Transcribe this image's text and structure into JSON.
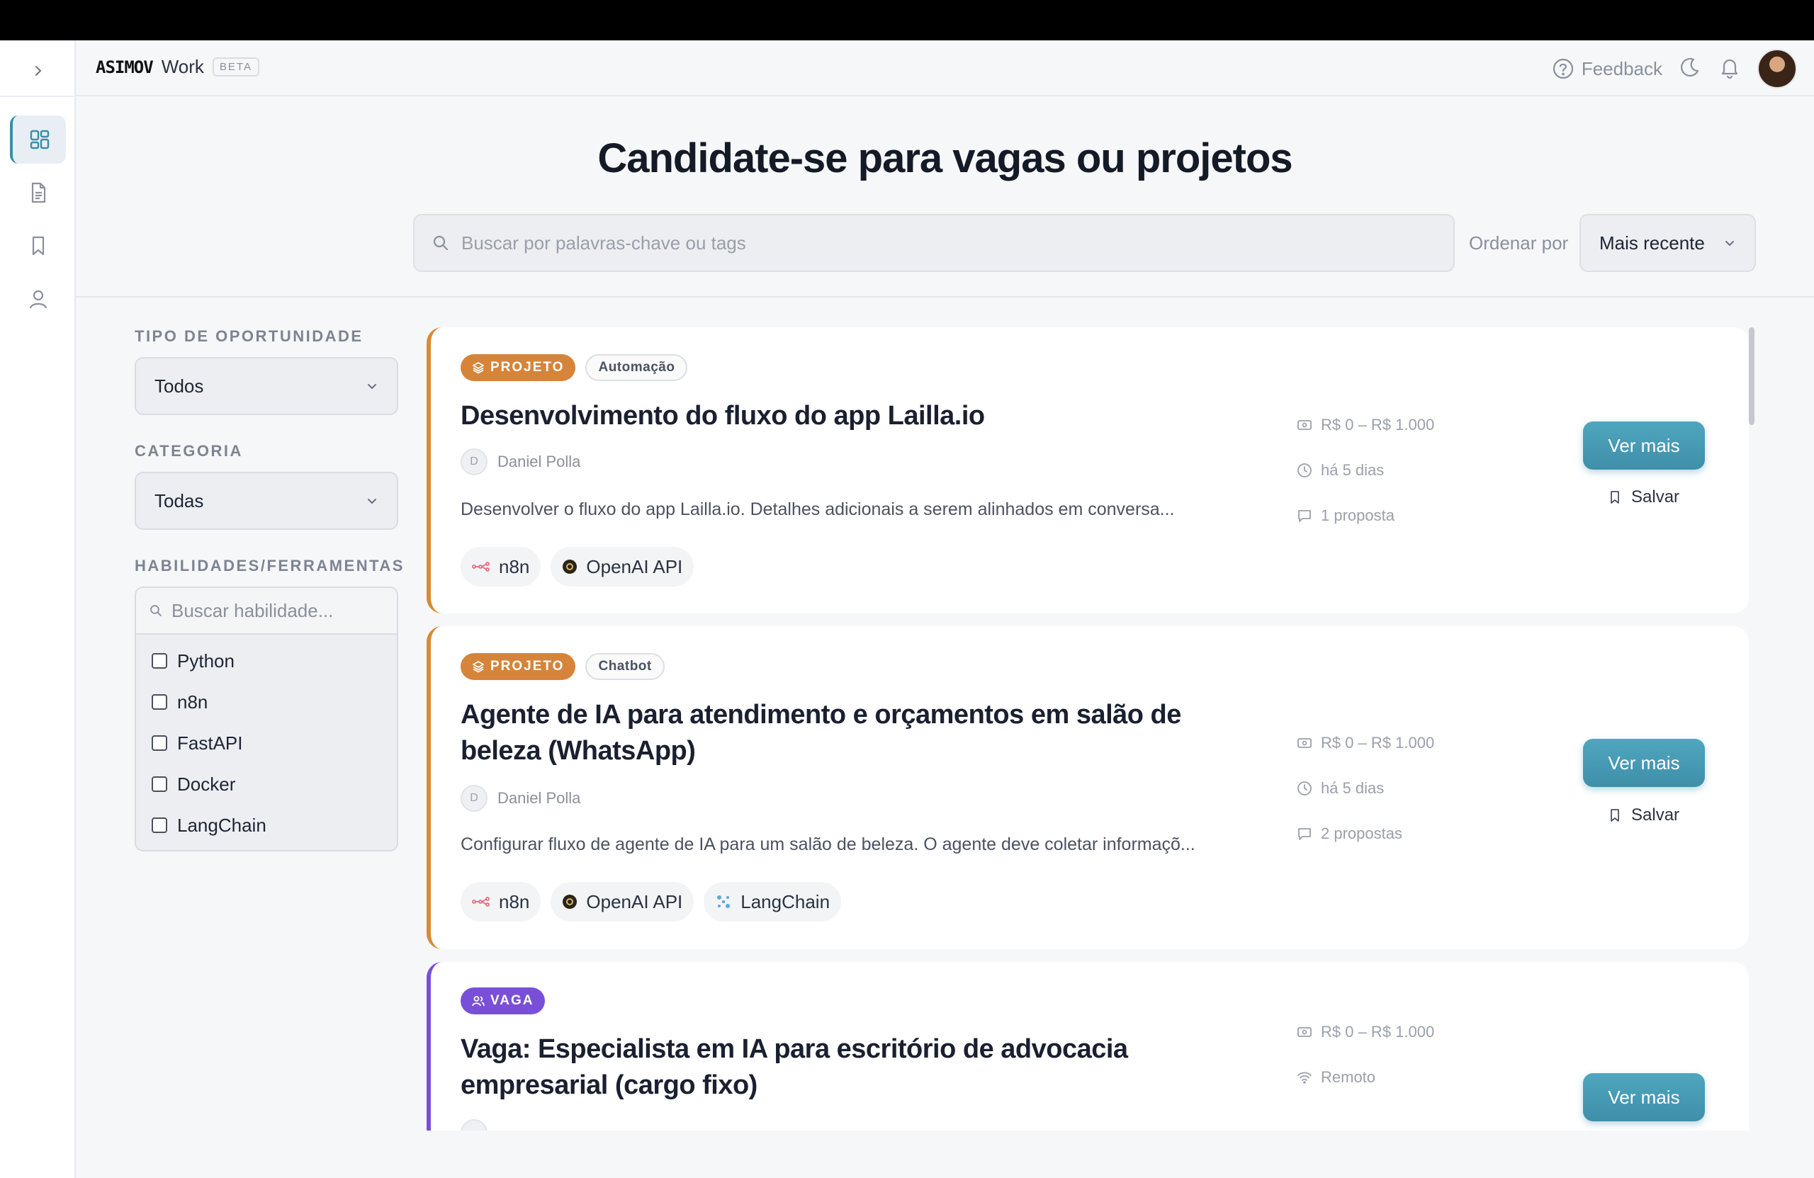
{
  "header": {
    "logo": "ASIMOV",
    "product": "Work",
    "beta": "BETA",
    "feedback": "Feedback"
  },
  "page": {
    "title": "Candidate-se para vagas ou projetos",
    "search_placeholder": "Buscar por palavras-chave ou tags",
    "sort_label": "Ordenar por",
    "sort_value": "Mais recente"
  },
  "filters": {
    "type_label": "TIPO DE OPORTUNIDADE",
    "type_value": "Todos",
    "category_label": "CATEGORIA",
    "category_value": "Todas",
    "skills_label": "HABILIDADES/FERRAMENTAS",
    "skills_placeholder": "Buscar habilidade...",
    "skills": [
      "Python",
      "n8n",
      "FastAPI",
      "Docker",
      "LangChain"
    ]
  },
  "cards": [
    {
      "type": "PROJETO",
      "tag": "Automação",
      "title": "Desenvolvimento do fluxo do app Lailla.io",
      "author_initial": "D",
      "author": "Daniel Polla",
      "description": "Desenvolver o fluxo do app Lailla.io. Detalhes adicionais a serem alinhados em conversa...",
      "chips": [
        "n8n",
        "OpenAI API"
      ],
      "budget": "R$ 0 – R$ 1.000",
      "posted": "há 5 dias",
      "proposals": "1 proposta",
      "view_label": "Ver mais",
      "save_label": "Salvar"
    },
    {
      "type": "PROJETO",
      "tag": "Chatbot",
      "title": "Agente de IA para atendimento e orçamentos em salão de beleza (WhatsApp)",
      "author_initial": "D",
      "author": "Daniel Polla",
      "description": "Configurar fluxo de agente de IA para um salão de beleza. O agente deve coletar informaçõ...",
      "chips": [
        "n8n",
        "OpenAI API",
        "LangChain"
      ],
      "budget": "R$ 0 – R$ 1.000",
      "posted": "há 5 dias",
      "proposals": "2 propostas",
      "view_label": "Ver mais",
      "save_label": "Salvar"
    },
    {
      "type": "VAGA",
      "title": "Vaga: Especialista em IA para escritório de advocacia empresarial (cargo fixo)",
      "budget": "R$ 0 – R$ 1.000",
      "location": "Remoto",
      "view_label": "Ver mais"
    }
  ]
}
